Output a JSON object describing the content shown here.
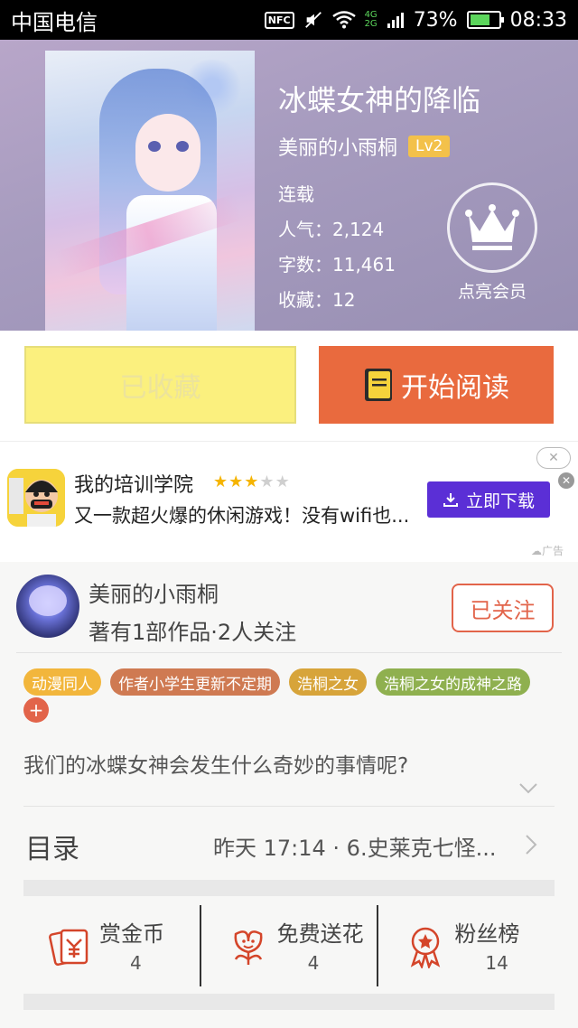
{
  "status_bar": {
    "carrier": "中国电信",
    "nfc": "NFC",
    "network_top": "4G",
    "network_bottom": "2G",
    "battery": "73%",
    "battery_level": 0.73,
    "time": "08:33"
  },
  "book": {
    "title": "冰蝶女神的降临",
    "author": "美丽的小雨桐",
    "level": "Lv2",
    "status": "连载",
    "popularity": "人气：2,124",
    "word_count": "字数：11,461",
    "favorites": "收藏：12",
    "vip_label": "点亮会员"
  },
  "actions": {
    "collected_label": "已收藏",
    "read_label": "开始阅读"
  },
  "ad": {
    "title": "我的培训学院",
    "rating": 3,
    "rating_max": 5,
    "description": "又一款超火爆的休闲游戏！没有wifi也...",
    "download_label": "立即下载",
    "ad_tag": "广告"
  },
  "author_profile": {
    "name": "美丽的小雨桐",
    "stats": "著有1部作品·2人关注",
    "follow_label": "已关注"
  },
  "tags": [
    {
      "label": "动漫同人",
      "color": "#f2b63c"
    },
    {
      "label": "作者小学生更新不定期",
      "color": "#cf7a52"
    },
    {
      "label": "浩桐之女",
      "color": "#d7a43a"
    },
    {
      "label": "浩桐之女的成神之路",
      "color": "#8fb04f"
    }
  ],
  "tag_add": "+",
  "synopsis": "我们的冰蝶女神会发生什么奇妙的事情呢?",
  "toc": {
    "label": "目录",
    "latest": "昨天 17:14 · 6.史莱克七怪..."
  },
  "features": [
    {
      "label": "赏金币",
      "count": "4",
      "icon": "red-envelope-yen-icon"
    },
    {
      "label": "免费送花",
      "count": "4",
      "icon": "flower-icon"
    },
    {
      "label": "粉丝榜",
      "count": "14",
      "icon": "medal-icon"
    }
  ],
  "colors": {
    "accent": "#e96a3e",
    "collected_bg": "#fbf07e",
    "ad_button": "#5b2fd6",
    "icon_red": "#d4452a"
  }
}
